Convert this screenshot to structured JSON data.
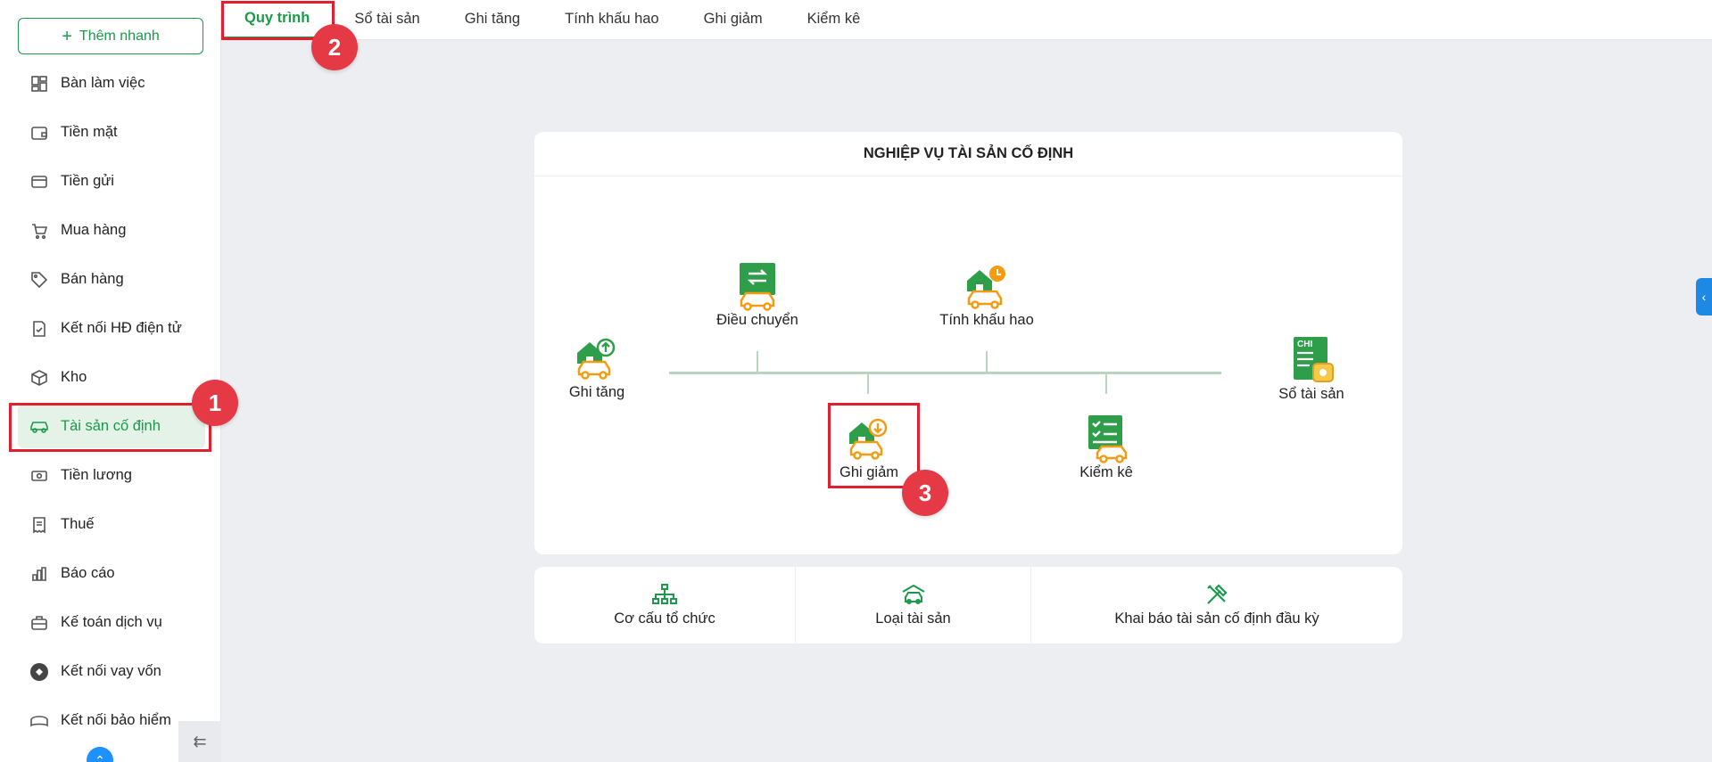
{
  "sidebar": {
    "quick_add_label": "Thêm nhanh",
    "items": [
      {
        "label": "Bàn làm việc",
        "icon": "dashboard-icon"
      },
      {
        "label": "Tiền mặt",
        "icon": "wallet-icon"
      },
      {
        "label": "Tiền gửi",
        "icon": "card-icon"
      },
      {
        "label": "Mua hàng",
        "icon": "cart-icon"
      },
      {
        "label": "Bán hàng",
        "icon": "tag-icon"
      },
      {
        "label": "Kết nối HĐ điện tử",
        "icon": "invoice-icon"
      },
      {
        "label": "Kho",
        "icon": "box-icon"
      },
      {
        "label": "Tài sản cố định",
        "icon": "car-icon",
        "active": true
      },
      {
        "label": "Tiền lương",
        "icon": "money-icon"
      },
      {
        "label": "Thuế",
        "icon": "receipt-icon"
      },
      {
        "label": "Báo cáo",
        "icon": "chart-icon"
      },
      {
        "label": "Kế toán dịch vụ",
        "icon": "briefcase-icon"
      },
      {
        "label": "Kết nối vay vốn",
        "icon": "loan-icon"
      },
      {
        "label": "Kết nối bảo hiểm",
        "icon": "umbrella-icon"
      }
    ]
  },
  "tabs": [
    "Quy trình",
    "Sổ tài sản",
    "Ghi tăng",
    "Tính khấu hao",
    "Ghi giảm",
    "Kiểm kê"
  ],
  "process": {
    "title": "NGHIỆP VỤ TÀI SẢN CỐ ĐỊNH",
    "nodes": {
      "ghi_tang": "Ghi tăng",
      "dieu_chuyen": "Điều chuyển",
      "tinh_khau_hao": "Tính khấu hao",
      "ghi_giam": "Ghi giảm",
      "kiem_ke": "Kiểm kê",
      "so_tai_san": "Sổ tài sản",
      "chi_badge": "CHI"
    }
  },
  "shortcuts": [
    "Cơ cấu tổ chức",
    "Loại tài sản",
    "Khai báo tài sản cố định đầu kỳ"
  ],
  "annotations": [
    "1",
    "2",
    "3"
  ],
  "colors": {
    "accent": "#1a9a4a",
    "highlight": "#e0202e",
    "badge": "#e53945",
    "icon_orange": "#f39c12"
  }
}
